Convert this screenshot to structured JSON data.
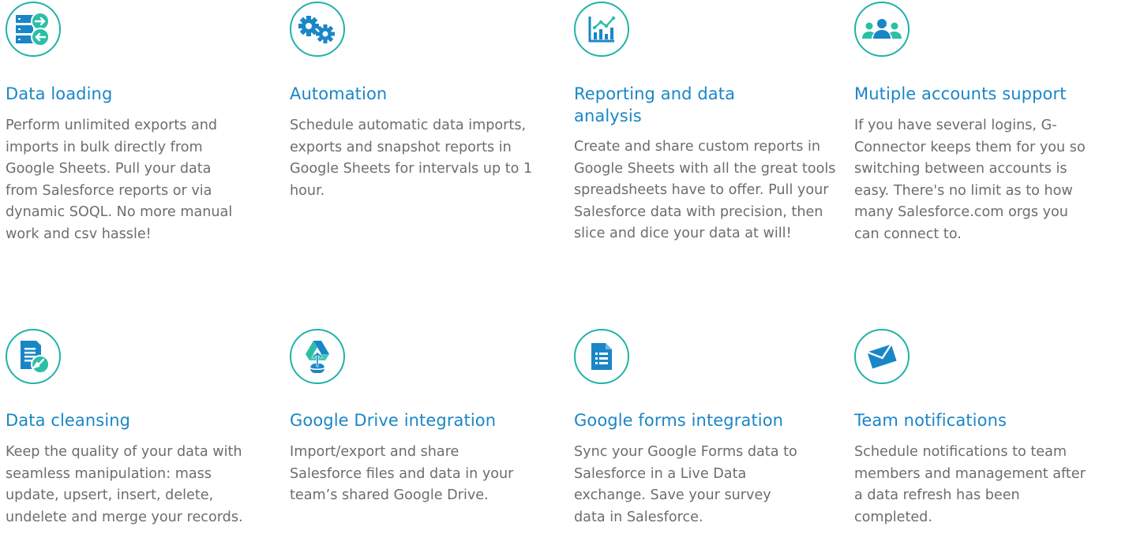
{
  "features": [
    {
      "title": "Data loading",
      "icon": "data-transfer-icon",
      "description": "Perform unlimited exports and imports in bulk directly from Google Sheets. Pull your data from Salesforce reports or via dynamic SOQL. No more manual work and csv hassle!"
    },
    {
      "title": "Automation",
      "icon": "gears-icon",
      "description": "Schedule automatic data imports, exports and snapshot reports in Google Sheets for intervals up to 1 hour."
    },
    {
      "title": "Reporting and data analysis",
      "icon": "chart-icon",
      "description": "Create and share custom reports in Google Sheets with all the great tools spreadsheets have to offer. Pull your Salesforce data with precision, then slice and dice your data at will!"
    },
    {
      "title": "Mutiple accounts support",
      "icon": "users-icon",
      "description": "If you have several logins, G-Connector keeps them for you so switching between accounts is easy. There's no limit as to how many Salesforce.com orgs you can connect to."
    },
    {
      "title": "Data cleansing",
      "icon": "document-clean-icon",
      "description": "Keep the quality of your data with seamless manipulation: mass update, upsert, insert, delete, undelete and merge your records."
    },
    {
      "title": "Google Drive integration",
      "icon": "google-drive-icon",
      "description": "Import/export and share Salesforce files and data in your team’s shared Google Drive."
    },
    {
      "title": "Google forms integration",
      "icon": "google-forms-icon",
      "description": "Sync your Google Forms data to Salesforce in a Live Data exchange. Save your survey data in Salesforce."
    },
    {
      "title": "Team notifications",
      "icon": "envelope-icon",
      "description": "Schedule notifications to team members and management after a data refresh has been completed."
    }
  ],
  "colors": {
    "title": "#1a86c7",
    "text": "#6d6d6d",
    "icon_border": "#1fb3a8",
    "icon_blue": "#1a86c7",
    "icon_teal": "#2bbfa6"
  }
}
